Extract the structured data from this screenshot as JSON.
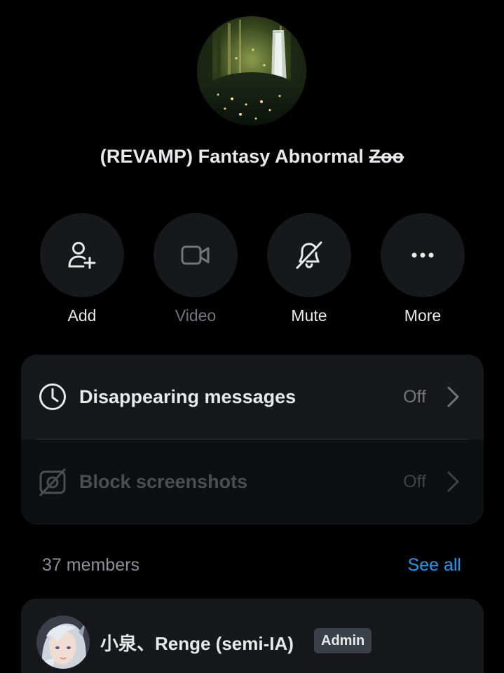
{
  "group": {
    "title_main": "(REVAMP) Fantasy Abnormal ",
    "title_strike": "Zoo"
  },
  "actions": [
    {
      "label": "Add",
      "icon": "add-person-icon"
    },
    {
      "label": "Video",
      "icon": "video-camera-icon"
    },
    {
      "label": "Mute",
      "icon": "bell-off-icon"
    },
    {
      "label": "More",
      "icon": "more-dots-icon"
    }
  ],
  "settings": [
    {
      "label": "Disappearing messages",
      "value": "Off",
      "icon": "clock-icon",
      "enabled": true
    },
    {
      "label": "Block screenshots",
      "value": "Off",
      "icon": "screenshot-block-icon",
      "enabled": false
    }
  ],
  "members": {
    "count_label": "37 members",
    "see_all_label": "See all",
    "list": [
      {
        "name": "小泉、Renge (semi-IA)",
        "badge": "Admin"
      }
    ]
  },
  "colors": {
    "background": "#000000",
    "card": "#16181c",
    "accent": "#1d9bf0",
    "muted": "#71767b"
  }
}
